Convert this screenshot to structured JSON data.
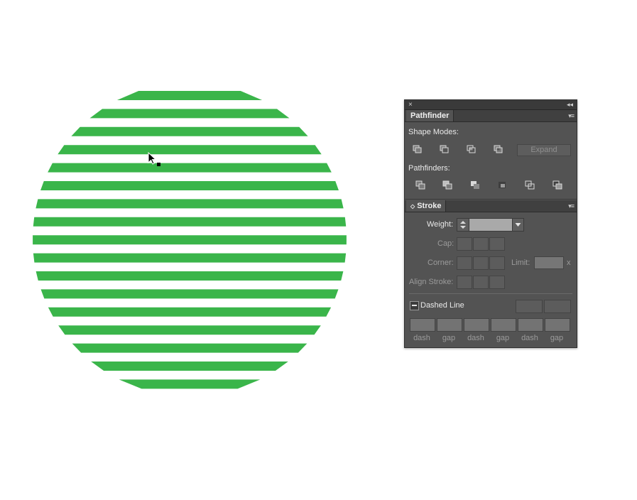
{
  "canvas": {
    "shape_color": "#3ab54a",
    "background_color": "#ffffff",
    "stripe_count": 17
  },
  "panel": {
    "close_glyph": "×",
    "collapse_glyph": "◂◂",
    "pathfinder_tab": "Pathfinder",
    "shape_modes_label": "Shape Modes:",
    "expand_label": "Expand",
    "pathfinders_label": "Pathfinders:",
    "stroke_tab": "◇ Stroke",
    "stroke_tab_text": "Stroke",
    "menu_glyph": "▾≡",
    "weight_label": "Weight:",
    "weight_value": "",
    "cap_label": "Cap:",
    "corner_label": "Corner:",
    "limit_label": "Limit:",
    "limit_unit": "x",
    "align_stroke_label": "Align Stroke:",
    "dashed_line_label": "Dashed Line",
    "dash_labels": [
      "dash",
      "gap",
      "dash",
      "gap",
      "dash",
      "gap"
    ]
  },
  "icons": {
    "shape_modes": [
      "unite-icon",
      "minus-front-icon",
      "intersect-icon",
      "exclude-icon"
    ],
    "pathfinders": [
      "divide-icon",
      "trim-icon",
      "merge-icon",
      "crop-icon",
      "outline-icon",
      "minus-back-icon"
    ]
  }
}
